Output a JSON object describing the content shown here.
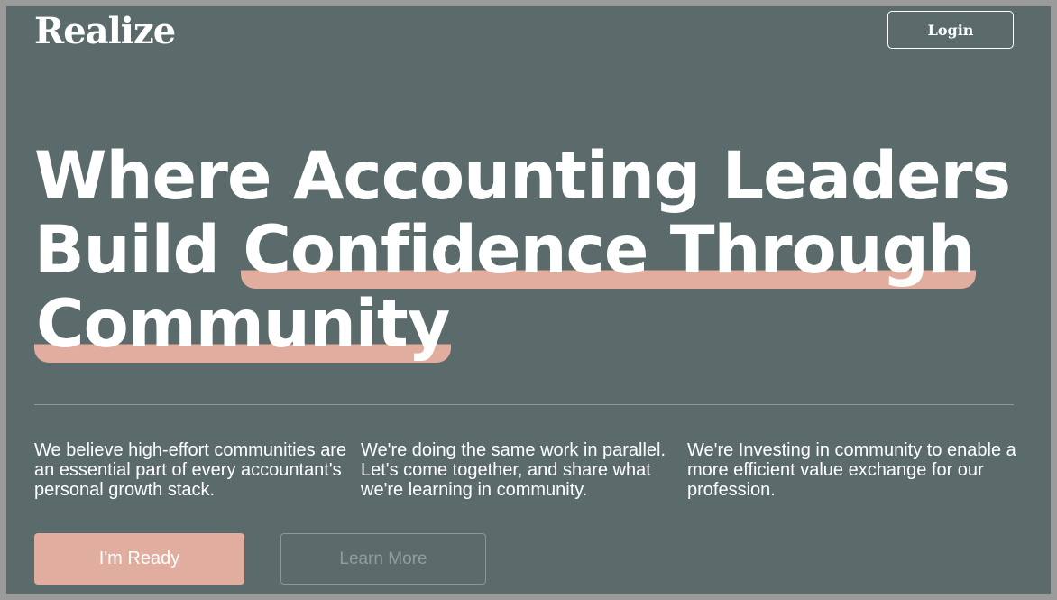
{
  "header": {
    "logo": "Realize",
    "login_label": "Login"
  },
  "hero": {
    "line1": "Where Accounting Leaders",
    "line2_plain": "Build ",
    "line2_highlight": "Confidence Through",
    "line3_highlight": "Community"
  },
  "columns": [
    {
      "text": "We believe high-effort communities are an essential part of every accountant's personal growth stack."
    },
    {
      "text": "We're doing the same work in parallel. Let's come together, and share what we're learning in community."
    },
    {
      "text": "We're Investing in community to enable a more efficient value exchange for our profession."
    }
  ],
  "actions": {
    "primary_label": "I'm Ready",
    "secondary_label": "Learn More"
  },
  "colors": {
    "background": "#5b6b6c",
    "accent": "#e1ad9e",
    "text": "#ffffff"
  }
}
